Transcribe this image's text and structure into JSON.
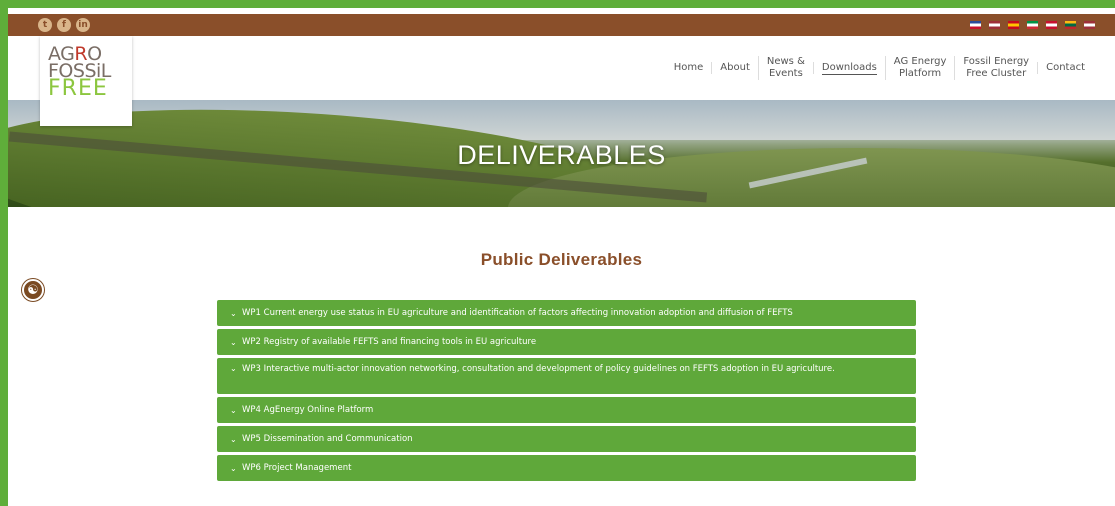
{
  "topbar": {
    "social": [
      {
        "icon": "twitter-icon",
        "glyph": "t"
      },
      {
        "icon": "facebook-icon",
        "glyph": "f"
      },
      {
        "icon": "linkedin-icon",
        "glyph": "in"
      }
    ],
    "flags": [
      {
        "icon": "flag-uk-icon",
        "colors": [
          "#2b4a9a",
          "#ffffff",
          "#c8102e"
        ]
      },
      {
        "icon": "flag-latvia-icon",
        "colors": [
          "#9e3039",
          "#ffffff",
          "#9e3039"
        ]
      },
      {
        "icon": "flag-spain-icon",
        "colors": [
          "#c60b1e",
          "#ffc400",
          "#c60b1e"
        ]
      },
      {
        "icon": "flag-italy-icon",
        "colors": [
          "#009246",
          "#ffffff",
          "#ce2b37"
        ]
      },
      {
        "icon": "flag-denmark-icon",
        "colors": [
          "#c8102e",
          "#ffffff",
          "#c8102e"
        ]
      },
      {
        "icon": "flag-lithuania-icon",
        "colors": [
          "#fdb913",
          "#006a44",
          "#c1272d"
        ]
      },
      {
        "icon": "flag-latvia2-icon",
        "colors": [
          "#9e3039",
          "#ffffff",
          "#9e3039"
        ]
      }
    ]
  },
  "logo": {
    "line1_a": "AG",
    "line1_b": "R",
    "line1_c": "O",
    "line2": "FOSSiL",
    "line3": "FREE"
  },
  "nav": {
    "items": [
      {
        "label1": "Home",
        "label2": ""
      },
      {
        "label1": "About",
        "label2": ""
      },
      {
        "label1": "News &",
        "label2": "Events"
      },
      {
        "label1": "Downloads",
        "label2": ""
      },
      {
        "label1": "AG Energy",
        "label2": "Platform"
      },
      {
        "label1": "Fossil Energy",
        "label2": "Free Cluster"
      },
      {
        "label1": "Contact",
        "label2": ""
      }
    ],
    "active_index": 3
  },
  "hero": {
    "title": "DELIVERABLES"
  },
  "content": {
    "section_title": "Public Deliverables",
    "accordion": [
      {
        "label": "WP1 Current energy use status in EU agriculture and identification of factors affecting innovation adoption and diffusion of FEFTS"
      },
      {
        "label": "WP2 Registry of available FEFTS and financing tools in EU agriculture"
      },
      {
        "label": "WP3 Interactive multi-actor innovation networking, consultation and development of policy guidelines on FEFTS adoption in EU agriculture."
      },
      {
        "label": "WP4 AgEnergy Online Platform"
      },
      {
        "label": "WP5 Dissemination and Communication"
      },
      {
        "label": "WP6 Project Management"
      }
    ]
  },
  "accessibility": {
    "icon": "accessibility-icon"
  },
  "colors": {
    "frame": "#5fae3a",
    "topbar": "#8a4f2a",
    "accordion": "#5fa83a",
    "section_title": "#8a4f2a"
  }
}
